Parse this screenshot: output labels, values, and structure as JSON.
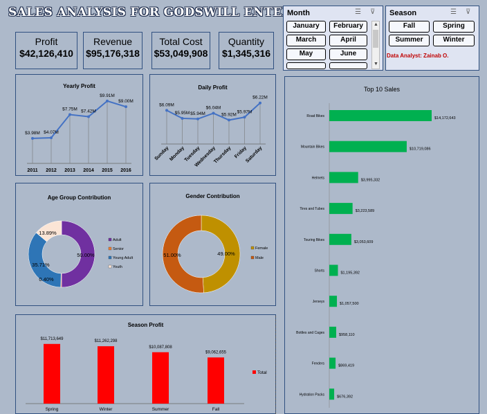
{
  "header": {
    "title": "SALES ANALYSIS FOR GODSWILL ENTERPRISE"
  },
  "kpis": [
    {
      "label": "Profit",
      "value": "$42,126,410"
    },
    {
      "label": "Revenue",
      "value": "$95,176,318"
    },
    {
      "label": "Total Cost",
      "value": "$53,049,908"
    },
    {
      "label": "Quantity",
      "value": "$1,345,316"
    }
  ],
  "slicers": {
    "month": {
      "title": "Month",
      "items": [
        "January",
        "February",
        "March",
        "April",
        "May",
        "June"
      ],
      "filter_icon": "multi-select-icon",
      "clear_icon": "clear-filter-icon"
    },
    "season": {
      "title": "Season",
      "items": [
        "Fall",
        "Spring",
        "Summer",
        "Winter"
      ],
      "filter_icon": "multi-select-icon",
      "clear_icon": "clear-filter-icon"
    }
  },
  "analyst": "Data Analyst: Zainab O.",
  "colors": {
    "background": "#adb9ca",
    "line": "#4472c4",
    "bar_green": "#00b050",
    "bar_red": "#ff0000",
    "adult": "#7030a0",
    "senior": "#ed7d31",
    "young_adult": "#2e75b6",
    "youth": "#fbe5d6",
    "female": "#bf9000",
    "male": "#c55a11"
  },
  "chart_data": [
    {
      "type": "line",
      "title": "Yearly Profit",
      "categories": [
        "2011",
        "2012",
        "2013",
        "2014",
        "2015",
        "2016"
      ],
      "values": [
        3.98,
        4.07,
        7.75,
        7.42,
        9.91,
        9.0
      ],
      "labels": [
        "$3.98M",
        "$4.07M",
        "$7.75M",
        "$7.42M",
        "$9.91M",
        "$9.00M"
      ],
      "ylim": [
        0,
        11
      ]
    },
    {
      "type": "line",
      "title": "Daily Profit",
      "categories": [
        "Sunday",
        "Monday",
        "Tuesday",
        "Wednesday",
        "Thursday",
        "Friday",
        "Saturday"
      ],
      "values": [
        6.09,
        5.95,
        5.94,
        6.04,
        5.92,
        5.97,
        6.22
      ],
      "labels": [
        "$6.09M",
        "$5.95M",
        "$5.94M",
        "$6.04M",
        "$5.92M",
        "$5.97M",
        "$6.22M"
      ],
      "ylim": [
        5.5,
        6.35
      ]
    },
    {
      "type": "pie",
      "title": "Age Group Contribution",
      "categories": [
        "Adult",
        "Senior",
        "Young Adult",
        "Youth"
      ],
      "values": [
        50.0,
        0.4,
        35.71,
        13.89
      ],
      "labels": [
        "50.00%",
        "0.40%",
        "35.71%",
        "13.89%"
      ],
      "legend": "right"
    },
    {
      "type": "pie",
      "title": "Gender Contribution",
      "categories": [
        "Female",
        "Male"
      ],
      "values": [
        49.0,
        51.0
      ],
      "labels": [
        "49.00%",
        "51.00%"
      ],
      "legend": "right"
    },
    {
      "type": "bar",
      "title": "Season Profit",
      "categories": [
        "Spring",
        "Winter",
        "Summer",
        "Fall"
      ],
      "series": [
        {
          "name": "Total",
          "values": [
            11713649,
            11262298,
            10087808,
            9062655
          ]
        }
      ],
      "labels": [
        "$11,713,649",
        "$11,262,298",
        "$10,087,808",
        "$9,062,655"
      ],
      "legend": "right"
    },
    {
      "type": "bar",
      "orientation": "horizontal",
      "title": "Top 10 Sales",
      "categories": [
        "Road Bikes",
        "Mountain Bikes",
        "Helmets",
        "Tires and Tubes",
        "Touring Bikes",
        "Shorts",
        "Jerseys",
        "Bottles and Cages",
        "Fenders",
        "Hydration Packs"
      ],
      "values": [
        14172643,
        10719086,
        3995332,
        3223589,
        3053609,
        1195392,
        1057500,
        958110,
        869419,
        676392
      ],
      "labels": [
        "$14,172,643",
        "$10,719,086",
        "$3,995,332",
        "$3,223,589",
        "$3,053,609",
        "$1,195,392",
        "$1,057,500",
        "$958,110",
        "$869,419",
        "$676,392"
      ]
    }
  ]
}
